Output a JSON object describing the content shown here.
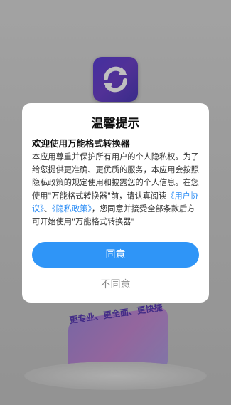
{
  "background": {
    "slogan": "更专业、更全面、更快捷"
  },
  "dialog": {
    "title": "温馨提示",
    "heading": "欢迎使用万能格式转换器",
    "body_part1": "本应用尊重并保护所有用户的个人隐私权。为了给您提供更准确、更优质的服务，本应用会按照隐私政策的规定使用和披露您的个人信息。在您使用\"万能格式转换器\"前，请认真阅读",
    "link_user_agreement": "《用户协议》",
    "separator": "、",
    "link_privacy_policy": "《隐私政策》",
    "body_part2": "，您同意并接受全部条款后方可开始使用\"万能格式转换器\"",
    "agree_label": "同意",
    "disagree_label": "不同意"
  },
  "colors": {
    "accent": "#2f95f7",
    "link": "#2a8cf5",
    "icon_bg": "#5b3fd6"
  },
  "icons": {
    "app": "refresh-arrows-icon"
  }
}
